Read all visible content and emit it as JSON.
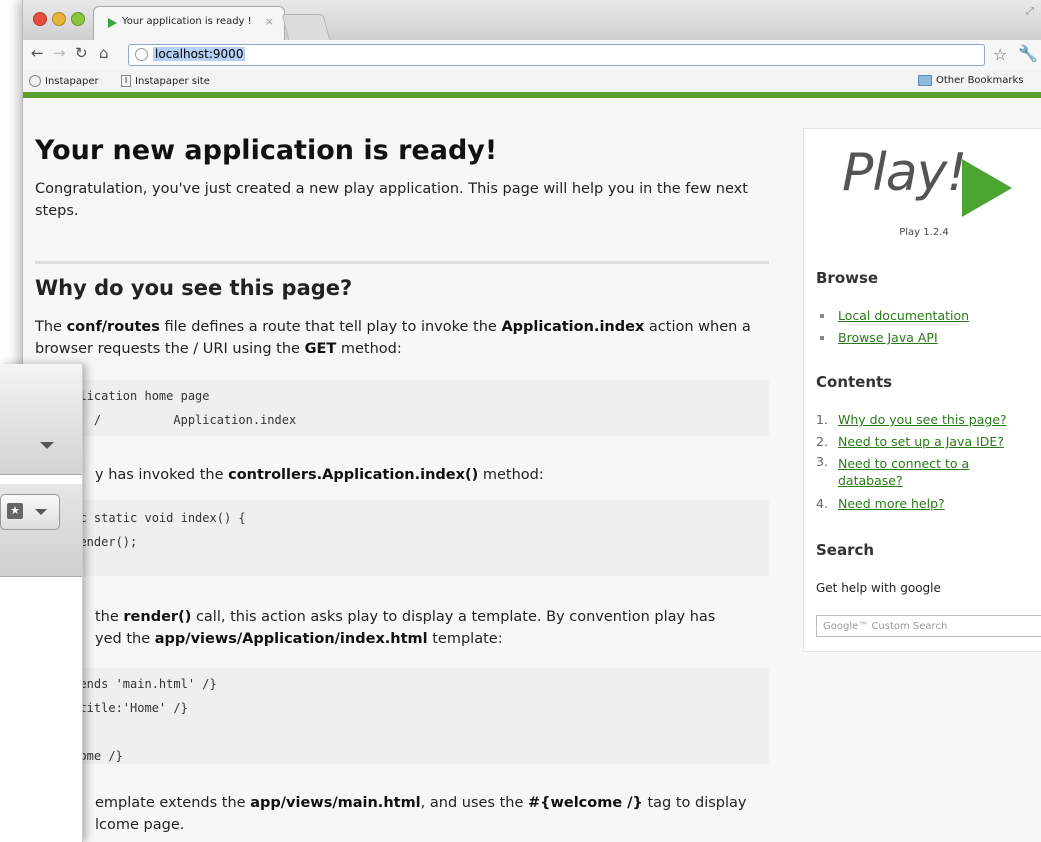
{
  "browser": {
    "tab_title": "Your application is ready !",
    "tab_close": "×",
    "url": "localhost:9000",
    "bookmarks": [
      "Instapaper",
      "Instapaper site"
    ],
    "other_bookmarks": "Other Bookmarks"
  },
  "page": {
    "title": "Your new application is ready!",
    "intro": "Congratulation, you've just created a new play application. This page will help you in the few next steps.",
    "section_title": "Why do you see this page?",
    "p1_a": "The ",
    "p1_b": "conf/routes",
    "p1_c": " file defines a route that tell play to invoke the ",
    "p1_d": "Application.index",
    "p1_e": " action when a browser requests the / URI using the ",
    "p1_f": "GET",
    "p1_g": " method:",
    "code1_l1": "pplication home page",
    "code1_l2": "    /          Application.index",
    "p2_a": "y has invoked the ",
    "p2_b": "controllers.Application.index()",
    "p2_c": " method:",
    "code2_l1": "lic static void index() {",
    "code2_l2": " render();",
    "p3_a": "the ",
    "p3_b": "render()",
    "p3_c": " call, this action asks play to display a template. By convention play has",
    "p3_d": "yed the ",
    "p3_e": "app/views/Application/index.html",
    "p3_f": " template:",
    "code3_l1": "xtends 'main.html' /}",
    "code3_l2": "t title:'Home' /}",
    "code3_l3": "lcome /}",
    "p4_a": "emplate extends the ",
    "p4_b": "app/views/main.html",
    "p4_c": ", and uses the ",
    "p4_d": "#{welcome /}",
    "p4_e": " tag to display",
    "p4_f": "lcome page."
  },
  "sidebar": {
    "logo": "Play!",
    "version": "Play 1.2.4",
    "browse_title": "Browse",
    "browse_links": [
      "Local documentation",
      "Browse Java API"
    ],
    "contents_title": "Contents",
    "contents": [
      {
        "num": "1.",
        "label": "Why do you see this page?"
      },
      {
        "num": "2.",
        "label": "Need to set up a Java IDE?"
      },
      {
        "num": "3.",
        "label": "Need to connect to a database?"
      },
      {
        "num": "4.",
        "label": "Need more help?"
      }
    ],
    "search_title": "Search",
    "search_help": "Get help with google",
    "search_placeholder": "Google™ Custom Search"
  },
  "colors": {
    "accent_green": "#5aa12e",
    "link": "#2a7a1a"
  }
}
